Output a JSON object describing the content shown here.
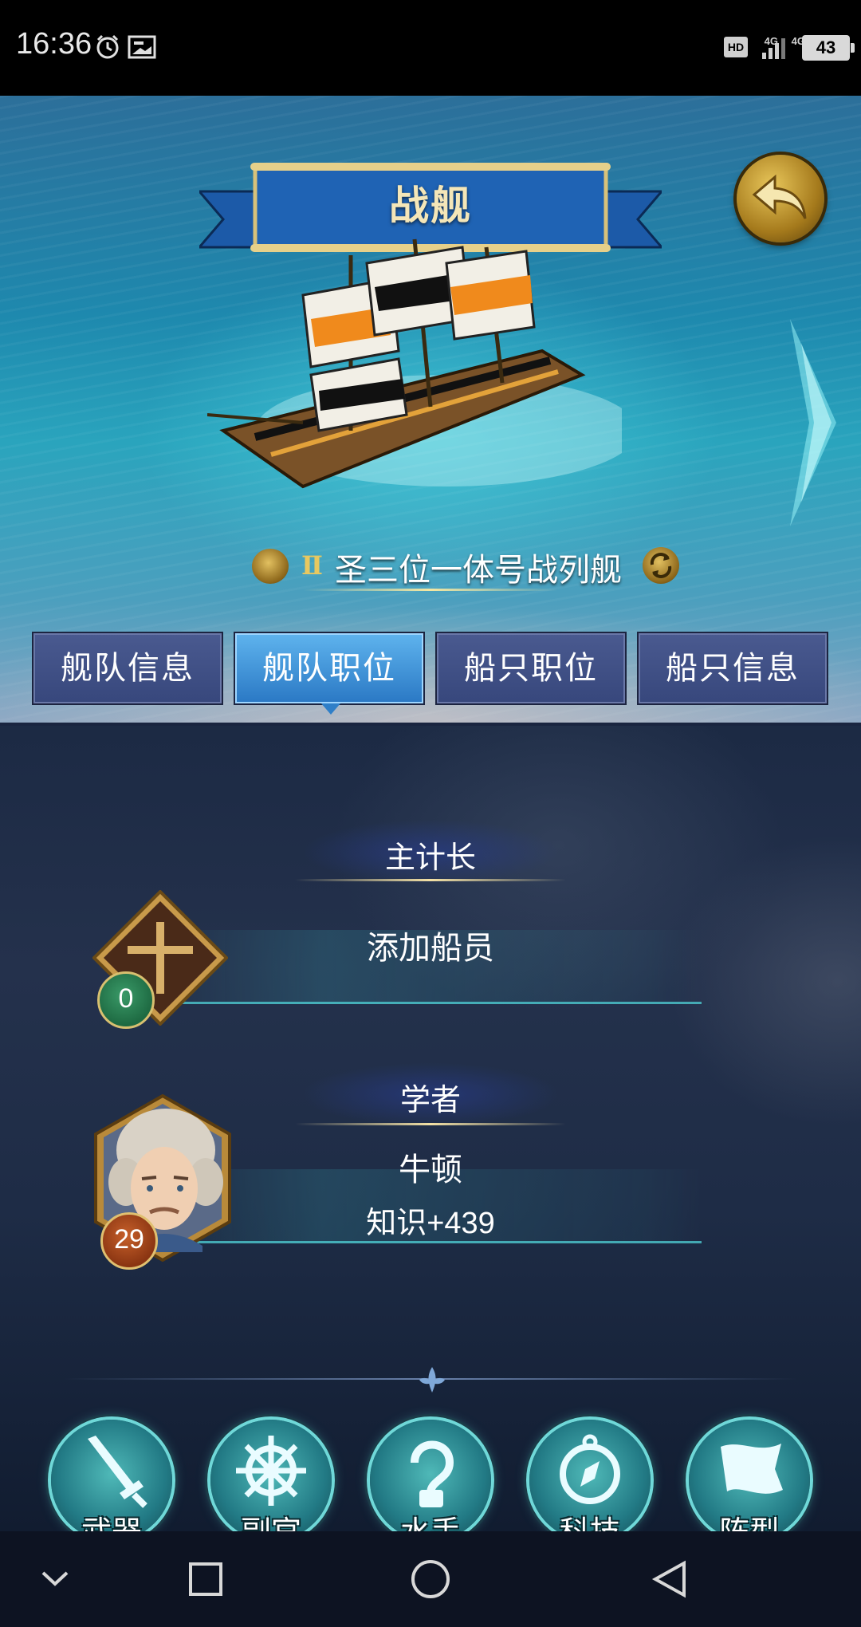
{
  "status_bar": {
    "time": "16:36",
    "hd_label": "HD",
    "net_1": "4G",
    "net_2": "4G",
    "battery": "43"
  },
  "header": {
    "title": "战舰",
    "back_icon": "back-arrow-icon",
    "next_icon": "chevron-right-icon"
  },
  "ship": {
    "tier": "Ⅱ",
    "name": "圣三位一体号战列舰"
  },
  "tabs": [
    {
      "label": "舰队信息",
      "active": false
    },
    {
      "label": "舰队职位",
      "active": true
    },
    {
      "label": "船只职位",
      "active": false
    },
    {
      "label": "船只信息",
      "active": false
    }
  ],
  "positions": [
    {
      "role": "主计长",
      "action": "添加船员",
      "level": "0"
    },
    {
      "role": "学者",
      "name": "牛顿",
      "bonus": "知识+439",
      "level": "29"
    }
  ],
  "bottom_nav": [
    {
      "label": "武器",
      "icon": "sword-icon"
    },
    {
      "label": "副官",
      "icon": "ship-wheel-icon"
    },
    {
      "label": "水手",
      "icon": "hook-icon"
    },
    {
      "label": "科技",
      "icon": "compass-icon"
    },
    {
      "label": "阵型",
      "icon": "flag-icon"
    }
  ],
  "system_nav": [
    "chevron-down-icon",
    "square-icon",
    "circle-icon",
    "triangle-back-icon"
  ]
}
